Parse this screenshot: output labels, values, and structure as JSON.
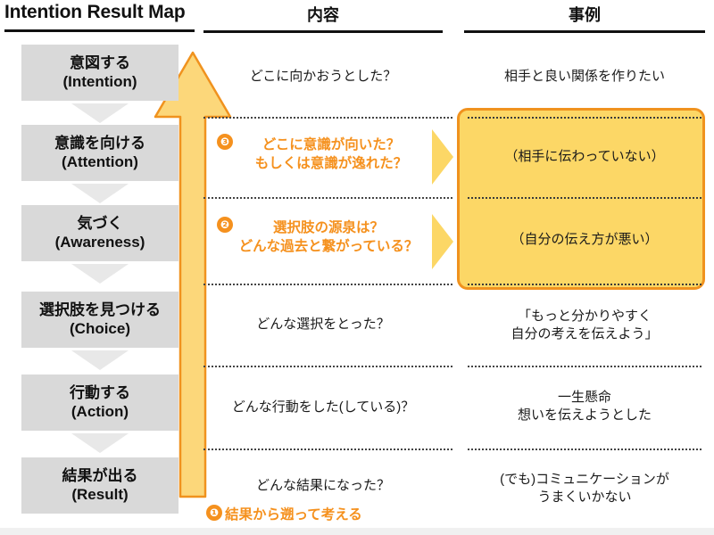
{
  "header": {
    "title": "Intention Result Map",
    "col_content": "内容",
    "col_example": "事例"
  },
  "stages": [
    {
      "jp": "意図する",
      "en": "(Intention)"
    },
    {
      "jp": "意識を向ける",
      "en": "(Attention)"
    },
    {
      "jp": "気づく",
      "en": "(Awareness)"
    },
    {
      "jp": "選択肢を見つける",
      "en": "(Choice)"
    },
    {
      "jp": "行動する",
      "en": "(Action)"
    },
    {
      "jp": "結果が出る",
      "en": "(Result)"
    }
  ],
  "rows": [
    {
      "content_lines": [
        "どこに向かおうとした？"
      ],
      "example_lines": [
        "相手と良い関係を作りたい"
      ],
      "highlighted": false
    },
    {
      "content_lines": [
        "どこに意識が向いた？",
        "もしくは意識が逸れた？"
      ],
      "example_lines": [
        "（相手に伝わっていない）"
      ],
      "highlighted": true,
      "badge": "❸"
    },
    {
      "content_lines": [
        "選択肢の源泉は？",
        "どんな過去と繋がっている？"
      ],
      "example_lines": [
        "（自分の伝え方が悪い）"
      ],
      "highlighted": true,
      "badge": "❷"
    },
    {
      "content_lines": [
        "どんな選択をとった？"
      ],
      "example_lines": [
        "「もっと分かりやすく",
        "自分の考えを伝えよう」"
      ],
      "highlighted": false
    },
    {
      "content_lines": [
        "どんな行動をした(している)？"
      ],
      "example_lines": [
        "一生懸命",
        "想いを伝えようとした"
      ],
      "highlighted": false
    },
    {
      "content_lines": [
        "どんな結果になった？"
      ],
      "example_lines": [
        "(でも)コミュニケーションが",
        "うまくいかない"
      ],
      "highlighted": false
    }
  ],
  "note": {
    "badge": "❶",
    "text": "結果から遡って考える"
  },
  "colors": {
    "accent_orange": "#f5911e",
    "fill_yellow": "#fcd766",
    "arrow_yellow": "#fcd77a",
    "arrow_stroke": "#f0921e",
    "stage_gray": "#d9d9d9",
    "chevron_gray": "#e8e8e8",
    "rule_black": "#111111"
  }
}
